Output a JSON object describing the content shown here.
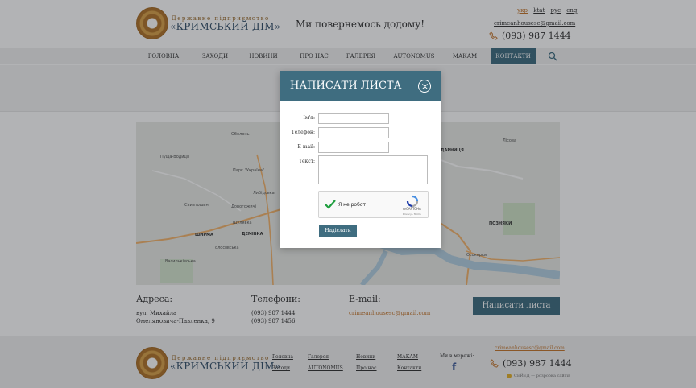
{
  "header": {
    "logo_subtitle": "Державне підприємство",
    "logo_title": "«КРИМСЬКИЙ ДІМ»",
    "slogan": "Ми повернемось додому!",
    "languages": [
      "укр",
      "ktat",
      "рус",
      "eng"
    ],
    "active_language": "укр",
    "email": "crimeanhousesc@gmail.com",
    "phone": "(093) 987 1444",
    "phone_icon": "phone-icon"
  },
  "nav": {
    "items": [
      "ГОЛОВНА",
      "ЗАХОДИ",
      "НОВИНИ",
      "ПРО НАС",
      "ГАЛЕРЕЯ",
      "AUTONOMUS",
      "МАКАМ",
      "КОНТАКТИ"
    ],
    "active": "КОНТАКТИ",
    "search_icon": "search-icon"
  },
  "map": {
    "labels": [
      "Оболонь",
      "Пуща-Водиця",
      "Парк \"Україна\"",
      "Либідська",
      "Свиатошин",
      "Дорогожичі",
      "Шулявка",
      "ШИРМА",
      "ДЕМІВКА",
      "Голосіївська",
      "Васильківська",
      "ПОЗНЯКИ",
      "Осокорки",
      "ДАРНИЦЯ",
      "Лісова"
    ]
  },
  "contacts": {
    "address_heading": "Адреса:",
    "address_lines": [
      "вул. Михайла",
      "Омеляновича-Павленка, 9"
    ],
    "phones_heading": "Телефони:",
    "phones": [
      "(093) 987 1444",
      "(093) 987 1456"
    ],
    "email_heading": "E-mail:",
    "email": "crimeanhousesc@gmail.com",
    "write_button": "Написати листа"
  },
  "footer": {
    "logo_subtitle": "Державне підприємство",
    "logo_title": "«КРИМСЬКИЙ ДІМ»",
    "links_col1": [
      "Головна",
      "Заходи"
    ],
    "links_col2": [
      "Галерея",
      "AUTONOMUS"
    ],
    "links_col3": [
      "Новини",
      "Про нас"
    ],
    "links_col4": [
      "МАКАМ",
      "Контакти"
    ],
    "social_title": "Ми в мережі:",
    "social_icon": "facebook-icon",
    "email": "crimeanhousesc@gmail.com",
    "phone": "(093) 987 1444",
    "developer": "СЕЙЕД — розробка сайтів"
  },
  "modal": {
    "title": "НАПИСАТИ ЛИСТА",
    "close_icon": "close-icon",
    "fields": {
      "name_label": "Ім'я:",
      "phone_label": "Телефон:",
      "email_label": "E-mail:",
      "text_label": "Текст:",
      "name_value": "",
      "phone_value": "",
      "email_value": "",
      "text_value": ""
    },
    "recaptcha": {
      "label": "Я не робот",
      "brand": "reCAPTCHA",
      "terms": "Privacy - Terms",
      "checked": true
    },
    "submit": "Надіслати"
  },
  "colors": {
    "accent": "#3f6d80",
    "link": "#c5762c",
    "overlay": "rgba(20,25,30,0.33)"
  }
}
